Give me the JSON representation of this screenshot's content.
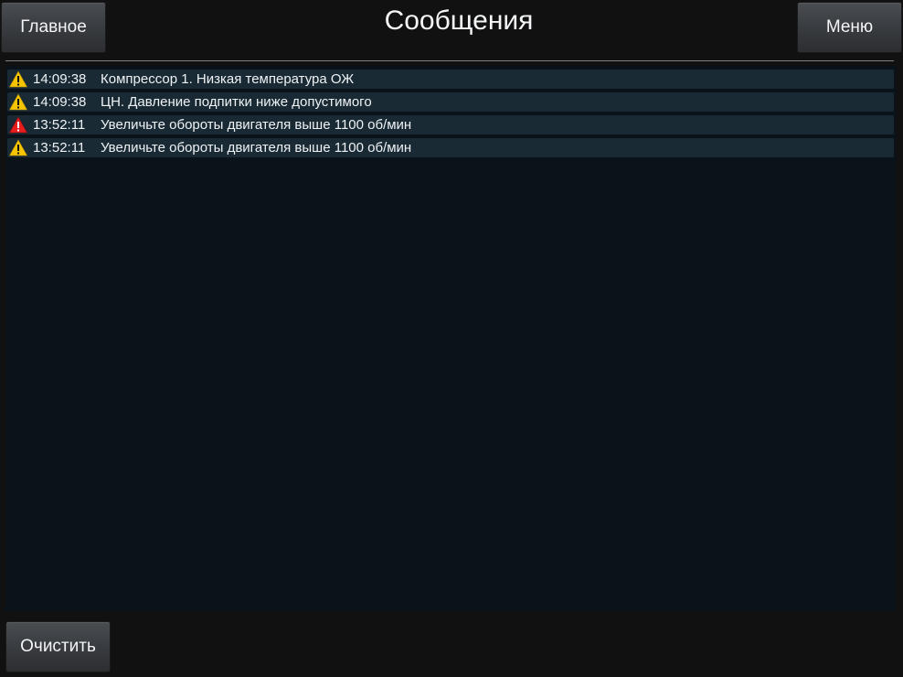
{
  "header": {
    "title": "Сообщения",
    "home_label": "Главное",
    "menu_label": "Меню"
  },
  "messages": [
    {
      "time": "14:09:38",
      "text": "Компрессор 1. Низкая температура ОЖ",
      "level": "warning",
      "icon": "warning-triangle-icon",
      "icon_color": "#f5c400"
    },
    {
      "time": "14:09:38",
      "text": "ЦН. Давление подпитки ниже допустимого",
      "level": "warning",
      "icon": "warning-triangle-icon",
      "icon_color": "#f5c400"
    },
    {
      "time": "13:52:11",
      "text": "Увеличьте обороты двигателя выше 1100 об/мин",
      "level": "alarm",
      "icon": "alarm-triangle-icon",
      "icon_color": "#e81d1d"
    },
    {
      "time": "13:52:11",
      "text": "Увеличьте обороты двигателя выше 1100 об/мин",
      "level": "warning",
      "icon": "warning-triangle-icon",
      "icon_color": "#f5c400"
    }
  ],
  "footer": {
    "clear_label": "Очистить"
  },
  "colors": {
    "background": "#111111",
    "panel": "#0b131a",
    "row": "#1a2a35",
    "warning": "#f5c400",
    "alarm": "#e81d1d"
  }
}
